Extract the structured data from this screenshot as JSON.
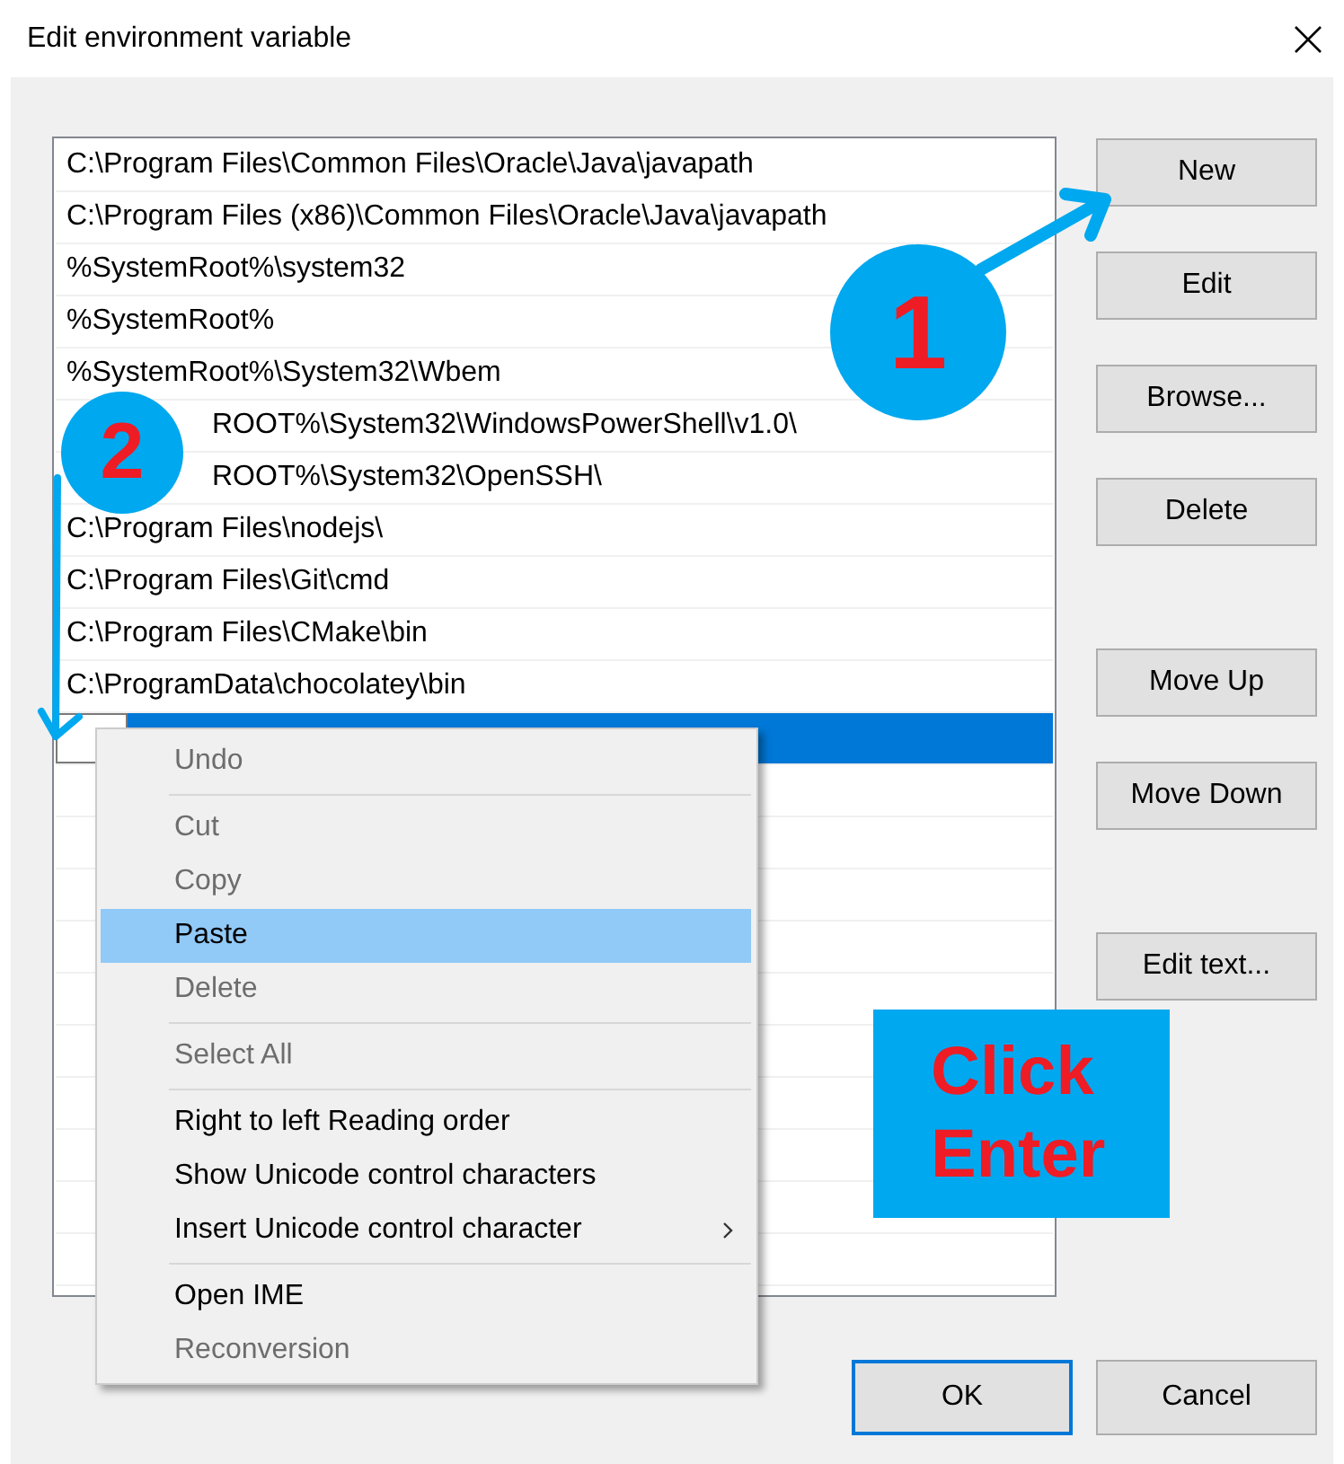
{
  "window": {
    "title": "Edit environment variable"
  },
  "path_list": {
    "rows": [
      {
        "kind": "text",
        "text": "C:\\Program Files\\Common Files\\Oracle\\Java\\javapath",
        "selected": false
      },
      {
        "kind": "text",
        "text": "C:\\Program Files (x86)\\Common Files\\Oracle\\Java\\javapath",
        "selected": false
      },
      {
        "kind": "text",
        "text": "%SystemRoot%\\system32",
        "selected": false
      },
      {
        "kind": "text",
        "text": "%SystemRoot%",
        "selected": false
      },
      {
        "kind": "text",
        "text": "%SystemRoot%\\System32\\Wbem",
        "selected": false
      },
      {
        "kind": "clipped",
        "text": "ROOT%\\System32\\WindowsPowerShell\\v1.0\\",
        "selected": false
      },
      {
        "kind": "clipped",
        "text": "ROOT%\\System32\\OpenSSH\\",
        "selected": false
      },
      {
        "kind": "text",
        "text": "C:\\Program Files\\nodejs\\",
        "selected": false
      },
      {
        "kind": "text",
        "text": "C:\\Program Files\\Git\\cmd",
        "selected": false
      },
      {
        "kind": "text",
        "text": "C:\\Program Files\\CMake\\bin",
        "selected": false
      },
      {
        "kind": "text",
        "text": "C:\\ProgramData\\chocolatey\\bin",
        "selected": false
      },
      {
        "kind": "editing",
        "selected": true
      }
    ]
  },
  "side_button_groups": [
    [
      "New",
      "Edit",
      "Browse...",
      "Delete"
    ],
    [
      "Move Up",
      "Move Down"
    ],
    [
      "Edit text..."
    ]
  ],
  "dialog_buttons": [
    {
      "label": "OK",
      "default": true
    },
    {
      "label": "Cancel",
      "default": false
    }
  ],
  "context_menu": {
    "items": [
      {
        "kind": "item",
        "label": "Undo",
        "disabled": true,
        "selected": false
      },
      {
        "kind": "separator"
      },
      {
        "kind": "item",
        "label": "Cut",
        "disabled": true,
        "selected": false
      },
      {
        "kind": "item",
        "label": "Copy",
        "disabled": true,
        "selected": false
      },
      {
        "kind": "item",
        "label": "Paste",
        "disabled": false,
        "selected": true
      },
      {
        "kind": "item",
        "label": "Delete",
        "disabled": true,
        "selected": false
      },
      {
        "kind": "separator"
      },
      {
        "kind": "item",
        "label": "Select All",
        "disabled": true,
        "selected": false
      },
      {
        "kind": "separator"
      },
      {
        "kind": "item",
        "label": "Right to left Reading order",
        "disabled": false,
        "selected": false
      },
      {
        "kind": "item",
        "label": "Show Unicode control characters",
        "disabled": false,
        "selected": false
      },
      {
        "kind": "submenu",
        "label": "Insert Unicode control character",
        "disabled": false,
        "selected": false
      },
      {
        "kind": "separator"
      },
      {
        "kind": "item",
        "label": "Open IME",
        "disabled": false,
        "selected": false
      },
      {
        "kind": "item",
        "label": "Reconversion",
        "disabled": true,
        "selected": false
      }
    ]
  },
  "annotations": [
    {
      "kind": "step",
      "label": "1"
    },
    {
      "kind": "step",
      "label": "2"
    },
    {
      "kind": "note",
      "lines": [
        "Click",
        "Enter"
      ]
    }
  ]
}
